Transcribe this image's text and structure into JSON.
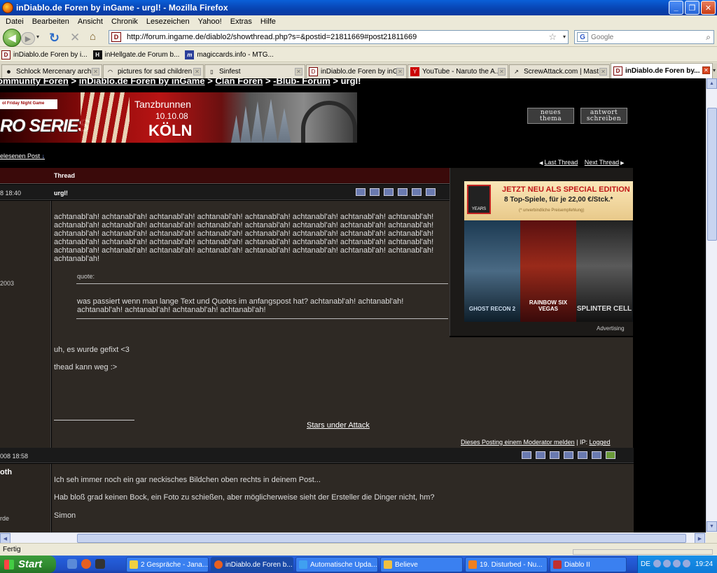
{
  "window": {
    "title": "inDiablo.de Foren by inGame - urgl! - Mozilla Firefox",
    "minimize": "_",
    "maximize": "❐",
    "close": "✕"
  },
  "menu": [
    "Datei",
    "Bearbeiten",
    "Ansicht",
    "Chronik",
    "Lesezeichen",
    "Yahoo!",
    "Extras",
    "Hilfe"
  ],
  "nav": {
    "url": "http://forum.ingame.de/diablo2/showthread.php?s=&postid=21811669#post21811669",
    "favicon": "D",
    "search_engine": "G",
    "search_placeholder": "Google",
    "icons": {
      "back": "◀",
      "forward": "▶",
      "dropdown": "▾",
      "reload": "↻",
      "stop": "✕",
      "home": "⌂",
      "bookmark_star": "☆",
      "search": "⌕"
    }
  },
  "bookmarks": [
    {
      "label": "inDiablo.de Foren by i...",
      "icon": "D",
      "style": "d"
    },
    {
      "label": "inHellgate.de Forum b...",
      "icon": "H",
      "style": "h"
    },
    {
      "label": "magiccards.info - MTG...",
      "icon": "m",
      "style": "m"
    }
  ],
  "tabs": [
    {
      "label": "Schlock Mercenary archi...",
      "icon": "☻"
    },
    {
      "label": "pictures for sad children",
      "icon": "◠"
    },
    {
      "label": "Sinfest",
      "icon": "▯"
    },
    {
      "label": "inDiablo.de Foren by inG...",
      "icon": "D"
    },
    {
      "label": "YouTube - Naruto the A...",
      "icon": "Y"
    },
    {
      "label": "ScrewAttack.com | Mast...",
      "icon": "↗"
    },
    {
      "label": "inDiablo.de Foren by...",
      "icon": "D",
      "active": true
    }
  ],
  "tab_close": "✕",
  "tab_list": "▾",
  "page": {
    "breadcrumb": {
      "items": [
        "ommunity Foren",
        "inDiablo.de Foren by inGame",
        "Clan Foren",
        "-Blub- Forum"
      ],
      "sep": ">",
      "current": "urgl!"
    },
    "banner": {
      "tag": "ol Friday Night Game",
      "series": "RO SERIES",
      "event": "Tanzbrunnen",
      "date": "10.10.08",
      "city": "KÖLN"
    },
    "buttons": {
      "new_topic": "neues\nthema",
      "reply": "antwort\nschreiben"
    },
    "last_read": "elesenen Post",
    "last_read_icon": "↓",
    "thread_nav": {
      "last": "Last Thread",
      "next": "Next Thread",
      "prev_arrow": "◀",
      "next_arrow": "▶"
    },
    "thread_header": "Thread",
    "post1": {
      "date": "8 18:40",
      "title": "urgl!",
      "joined": "2003",
      "text": "achtanabl'ah! achtanabl'ah! achtanabl'ah! achtanabl'ah! achtanabl'ah! achtanabl'ah! achtanabl'ah! achtanabl'ah! achtanabl'ah! achtanabl'ah! achtanabl'ah! achtanabl'ah! achtanabl'ah! achtanabl'ah! achtanabl'ah! achtanabl'ah! achtanabl'ah! achtanabl'ah! achtanabl'ah! achtanabl'ah! achtanabl'ah! achtanabl'ah! achtanabl'ah! achtanabl'ah! achtanabl'ah! achtanabl'ah! achtanabl'ah! achtanabl'ah! achtanabl'ah! achtanabl'ah! achtanabl'ah! achtanabl'ah! achtanabl'ah! achtanabl'ah! achtanabl'ah! achtanabl'ah! achtanabl'ah! achtanabl'ah! achtanabl'ah! achtanabl'ah! achtanabl'ah!",
      "quote_label": "quote:",
      "quote": "was passiert wenn man lange Text und Quotes im anfangspost hat? achtanabl'ah! achtanabl'ah! achtanabl'ah! achtanabl'ah! achtanabl'ah! achtanabl'ah!",
      "line1": "uh, es wurde gefixt <3",
      "line2": "thead kann weg :>",
      "signature": "Stars under Attack",
      "report": "Dieses Posting einem Moderator melden",
      "ip_label": "| IP:",
      "ip": "Logged"
    },
    "post2": {
      "date": "008 18:58",
      "user": "oth",
      "info": "rde",
      "line1": "Ich seh immer noch ein gar neckisches Bildchen oben rechts in deinem Post...",
      "line2": "Hab bloß grad keinen Bock, ein Foto zu schießen, aber möglicherweise sieht der Ersteller die Dinger nicht, hm?",
      "sign": "Simon"
    },
    "ad": {
      "headline": "JETZT NEU ALS SPECIAL EDITION",
      "offer": "8 Top-Spiele, für je 22,00 €/Stck.*",
      "note": "(* unverbindliche Preisempfehlung)",
      "years": "YEARS",
      "games": [
        "GHOST RECON 2",
        "RAINBOW SIX VEGAS",
        "SPLINTER CELL"
      ],
      "label": "Advertising"
    }
  },
  "scroll": {
    "up": "▲",
    "down": "▼",
    "left": "◀",
    "right": "▶"
  },
  "status": "Fertig",
  "taskbar": {
    "start": "Start",
    "tasks": [
      {
        "label": "2 Gespräche - Jana...",
        "color": "#f0d040"
      },
      {
        "label": "inDiablo.de Foren b...",
        "color": "#e86020",
        "active": true
      },
      {
        "label": "Automatische Upda...",
        "color": "#40a0f0"
      },
      {
        "label": "Believe",
        "color": "#f0c040"
      },
      {
        "label": "19. Disturbed - Nu...",
        "color": "#f08020"
      },
      {
        "label": "Diablo II",
        "color": "#c03030"
      }
    ],
    "language": "DE",
    "clock": "19:24"
  }
}
